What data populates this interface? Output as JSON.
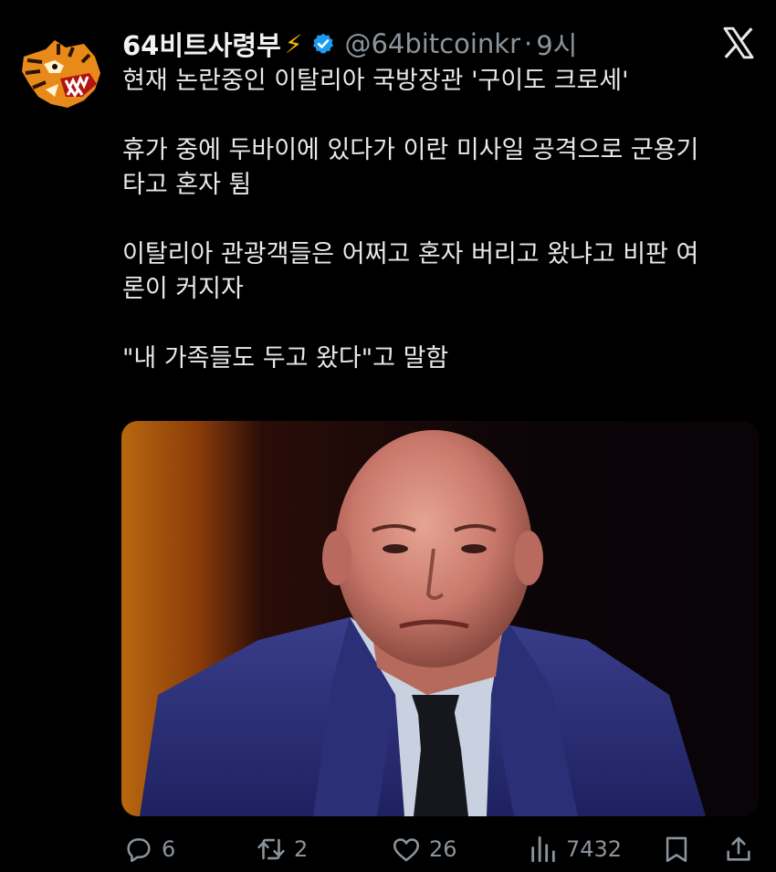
{
  "account": {
    "name": "64비트사령부",
    "bolt": "⚡",
    "handle": "@64bitcoinkr",
    "separator": "·",
    "time": "9시"
  },
  "tweet": {
    "lines": [
      "현재 논란중인 이탈리아 국방장관 '구이도 크로세'",
      "휴가 중에 두바이에 있다가 이란 미사일 공격으로 군용기",
      "타고 혼자 튐",
      "이탈리아 관광객들은 어쩌고 혼자 버리고 왔냐고 비판 여",
      "론이 커지자",
      "\"내 가족들도 두고 왔다\"고 말함"
    ]
  },
  "actions": {
    "replies": "6",
    "reposts": "2",
    "likes": "26",
    "views": "7432"
  },
  "icons": {
    "verified": "verified-badge-icon",
    "x_logo": "x-logo-icon",
    "reply": "reply-icon",
    "repost": "repost-icon",
    "like": "heart-icon",
    "views": "views-icon",
    "bookmark": "bookmark-icon",
    "share": "share-icon"
  },
  "colors": {
    "background": "#000000",
    "text": "#e7e9ea",
    "muted": "#8b949c",
    "verified": "#1d9bf0",
    "bolt": "#f5b400"
  }
}
